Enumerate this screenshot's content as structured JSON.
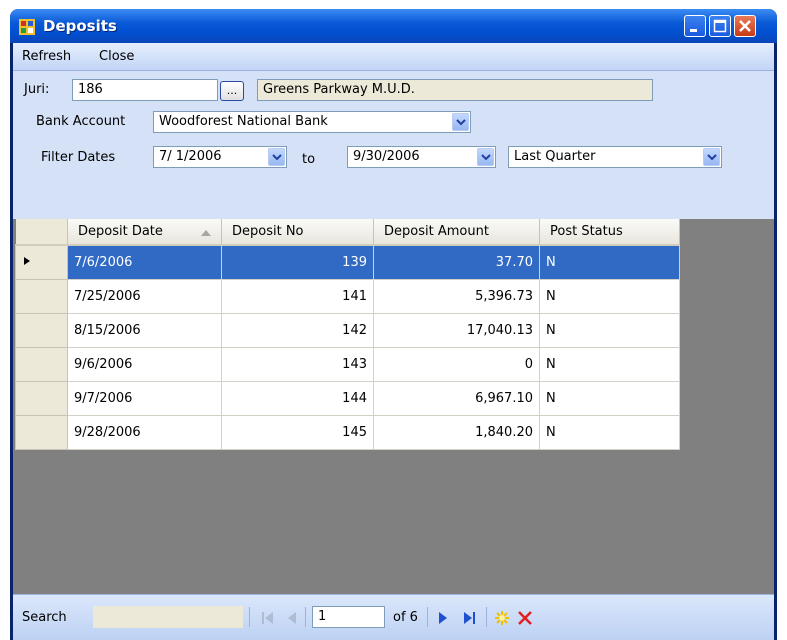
{
  "window": {
    "title": "Deposits"
  },
  "menu": {
    "refresh": "Refresh",
    "close": "Close"
  },
  "form": {
    "juri_label": "Juri:",
    "juri_value": "186",
    "lookup_button": "...",
    "juri_name": "Greens Parkway M.U.D.",
    "bank_label": "Bank Account",
    "bank_value": "Woodforest National Bank",
    "filter_label": "Filter Dates",
    "date_from": "7/ 1/2006",
    "to_label": "to",
    "date_to": "9/30/2006",
    "range_value": "Last Quarter"
  },
  "grid": {
    "columns": [
      "Deposit Date",
      "Deposit No",
      "Deposit Amount",
      "Post Status"
    ],
    "rows": [
      {
        "date": "7/6/2006",
        "no": "139",
        "amount": "37.70",
        "status": "N"
      },
      {
        "date": "7/25/2006",
        "no": "141",
        "amount": "5,396.73",
        "status": "N"
      },
      {
        "date": "8/15/2006",
        "no": "142",
        "amount": "17,040.13",
        "status": "N"
      },
      {
        "date": "9/6/2006",
        "no": "143",
        "amount": "0",
        "status": "N"
      },
      {
        "date": "9/7/2006",
        "no": "144",
        "amount": "6,967.10",
        "status": "N"
      },
      {
        "date": "9/28/2006",
        "no": "145",
        "amount": "1,840.20",
        "status": "N"
      }
    ]
  },
  "status": {
    "search_label": "Search",
    "position": "1",
    "of_total": "of 6"
  },
  "colors": {
    "selection": "#316ac5",
    "titlebar": "#0a5ad8",
    "delete": "#e02020",
    "add": "#f0c000"
  }
}
